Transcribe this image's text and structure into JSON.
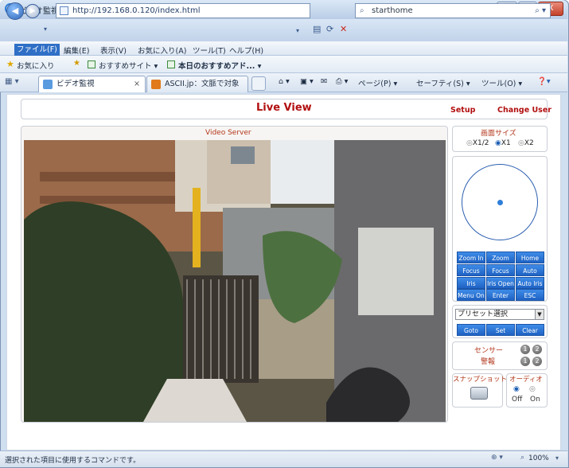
{
  "window": {
    "title": "ビデオ監視 - Windows Internet Explorer",
    "controls": {
      "minimize": "–",
      "maximize": "□",
      "close": "X"
    }
  },
  "nav": {
    "url": "http://192.168.0.120/index.html",
    "search_value": "starthome"
  },
  "menubar": [
    "ファイル(F)",
    "編集(E)",
    "表示(V)",
    "お気に入り(A)",
    "ツール(T)",
    "ヘルプ(H)"
  ],
  "favorites": {
    "label": "お気に入り",
    "items": [
      "おすすめサイト ▾",
      "本日のおすすめアド... ▾"
    ]
  },
  "tabs": [
    {
      "label": "ビデオ監視"
    },
    {
      "label": "ASCII.jp：文脈で対象が..."
    }
  ],
  "commandbar": [
    "ページ(P) ▾",
    "セーフティ(S) ▾",
    "ツール(O) ▾"
  ],
  "page": {
    "title": "Live View",
    "links": [
      "Setup",
      "Change User"
    ],
    "video_label": "Video Server"
  },
  "screen_size": {
    "label": "画面サイズ",
    "options": [
      "X1/2",
      "X1",
      "X2"
    ],
    "selected": "X1"
  },
  "controls": {
    "buttons": [
      [
        "Zoom In",
        "Zoom Out",
        "Home"
      ],
      [
        "Focus Near",
        "Focus Far",
        "Auto Focus"
      ],
      [
        "Iris Close",
        "Iris Open",
        "Auto Iris"
      ],
      [
        "Menu On",
        "Enter",
        "ESC"
      ]
    ]
  },
  "preset": {
    "select_value": "プリセット選択",
    "buttons": [
      "Goto",
      "Set",
      "Clear"
    ]
  },
  "sensor": {
    "label_line1": "センサー",
    "label_line2": "警報",
    "indicators": [
      "1",
      "2",
      "1",
      "2"
    ]
  },
  "snapshot": {
    "label": "スナップショット"
  },
  "audio": {
    "label": "オーディオ",
    "options": [
      "Off",
      "On"
    ],
    "selected": "Off"
  },
  "statusbar": {
    "text": "選択された項目に使用するコマンドです。",
    "zoom": "100%"
  }
}
